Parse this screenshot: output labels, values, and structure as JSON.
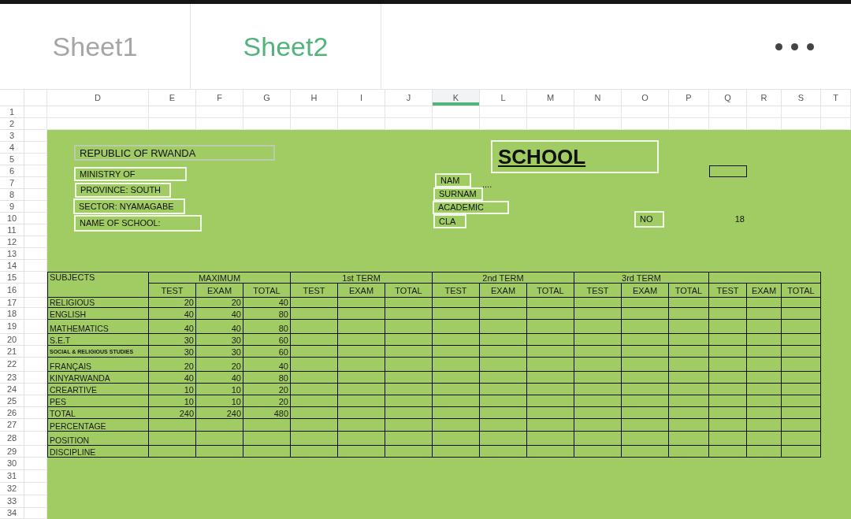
{
  "tabs": [
    {
      "label": "Sheet1",
      "selected": false
    },
    {
      "label": "Sheet2",
      "selected": true
    }
  ],
  "columns": [
    {
      "label": "D",
      "selected": false
    },
    {
      "label": "E",
      "selected": false
    },
    {
      "label": "F",
      "selected": false
    },
    {
      "label": "G",
      "selected": false
    },
    {
      "label": "H",
      "selected": false
    },
    {
      "label": "I",
      "selected": false
    },
    {
      "label": "J",
      "selected": false
    },
    {
      "label": "K",
      "selected": true
    },
    {
      "label": "L",
      "selected": false
    },
    {
      "label": "M",
      "selected": false
    },
    {
      "label": "N",
      "selected": false
    },
    {
      "label": "O",
      "selected": false
    },
    {
      "label": "P",
      "selected": false
    },
    {
      "label": "Q",
      "selected": false
    },
    {
      "label": "R",
      "selected": false
    },
    {
      "label": "S",
      "selected": false
    },
    {
      "label": "T",
      "selected": false
    }
  ],
  "row_numbers": [
    "1",
    "2",
    "3",
    "4",
    "5",
    "6",
    "7",
    "8",
    "9",
    "10",
    "11",
    "12",
    "13",
    "14",
    "15",
    "16",
    "17",
    "18",
    "19",
    "20",
    "21",
    "22",
    "23",
    "24",
    "25",
    "26",
    "27",
    "28",
    "29",
    "30",
    "31",
    "32",
    "33",
    "34"
  ],
  "text_boxes": [
    {
      "kind": "heading",
      "text": "REPUBLIC OF RWANDA"
    },
    {
      "kind": "label",
      "text": "MINISTRY OF"
    },
    {
      "kind": "label",
      "text": "PROVINCE: SOUTH"
    },
    {
      "kind": "label",
      "text": "SECTOR: NYAMAGABE"
    },
    {
      "kind": "label",
      "text": "NAME OF SCHOOL:"
    },
    {
      "kind": "title",
      "text": "SCHOOL"
    },
    {
      "kind": "label",
      "text": "NAM"
    },
    {
      "kind": "label",
      "text": "SURNAM"
    },
    {
      "kind": "label",
      "text": "ACADEMIC"
    },
    {
      "kind": "label",
      "text": "CLA"
    },
    {
      "kind": "label",
      "text": "NO"
    }
  ],
  "cells": [
    {
      "text": "...."
    },
    {
      "text": "18"
    }
  ],
  "table": {
    "corner_header": "SUBJECTS",
    "group_headers": [
      "MAXIMUM",
      "1st TERM",
      "2nd TERM",
      "3rd TERM"
    ],
    "sub_headers": [
      "TEST",
      "EXAM",
      "TOTAL",
      "TEST",
      "EXAM",
      "TOTAL",
      "TEST",
      "EXAM",
      "TOTAL",
      "TEST",
      "EXAM",
      "TOTAL",
      "TEST",
      "EXAM",
      "TOTAL"
    ],
    "rows": [
      {
        "subject": "RELIGIOUS",
        "values": [
          "20",
          "20",
          "40"
        ]
      },
      {
        "subject": "ENGLISH",
        "values": [
          "40",
          "40",
          "80"
        ]
      },
      {
        "subject": "MATHEMATICS",
        "values": [
          "40",
          "40",
          "80"
        ]
      },
      {
        "subject": "S.E.T",
        "values": [
          "30",
          "30",
          "60"
        ]
      },
      {
        "subject": "SOCIAL & RELIGIOUS STUDIES",
        "values": [
          "30",
          "30",
          "60"
        ]
      },
      {
        "subject": "FRANÇAIS",
        "values": [
          "20",
          "20",
          "40"
        ]
      },
      {
        "subject": "KINYARWANDA",
        "values": [
          "40",
          "40",
          "80"
        ]
      },
      {
        "subject": "CREARTIVE",
        "values": [
          "10",
          "10",
          "20"
        ]
      },
      {
        "subject": "PES",
        "values": [
          "10",
          "10",
          "20"
        ]
      },
      {
        "subject": "TOTAL",
        "values": [
          "240",
          "240",
          "480"
        ]
      },
      {
        "subject": "PERCENTAGE"
      },
      {
        "subject": "POSITION"
      },
      {
        "subject": "DISCIPLINE"
      }
    ]
  }
}
